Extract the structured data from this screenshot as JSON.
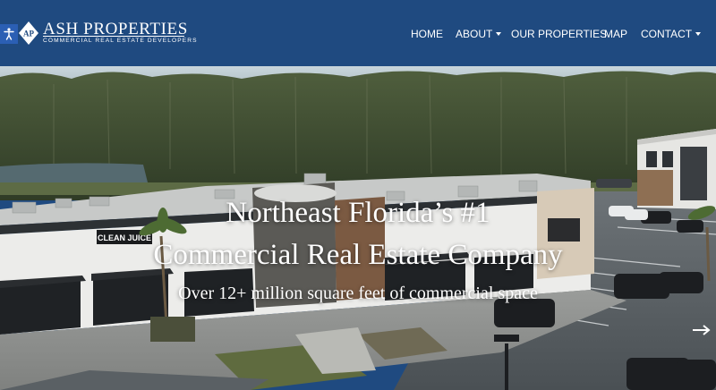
{
  "header": {
    "logo_name": "ASH PROPERTIES",
    "logo_tagline": "COMMERCIAL REAL ESTATE DEVELOPERS",
    "logo_mark": "AP",
    "accessibility_icon": "accessibility-icon"
  },
  "nav": {
    "items": [
      {
        "label": "HOME",
        "has_dropdown": false
      },
      {
        "label": "ABOUT",
        "has_dropdown": true
      },
      {
        "label": "OUR PROPERTIES",
        "has_dropdown": false
      },
      {
        "label": "MAP",
        "has_dropdown": false
      },
      {
        "label": "CONTACT",
        "has_dropdown": true
      }
    ]
  },
  "hero": {
    "headline_line1": "Northeast Florida’s #1",
    "headline_line2": "Commercial Real Estate Company",
    "subheadline": "Over 12+ million square feet of commercial space",
    "storefront_sign": "CLEAN JUICE",
    "slider_arrow_icon": "arrow-right-icon"
  },
  "colors": {
    "header_bg": "#1f4a80",
    "text": "#ffffff",
    "accessibility_bg": "#2b5fb4"
  }
}
